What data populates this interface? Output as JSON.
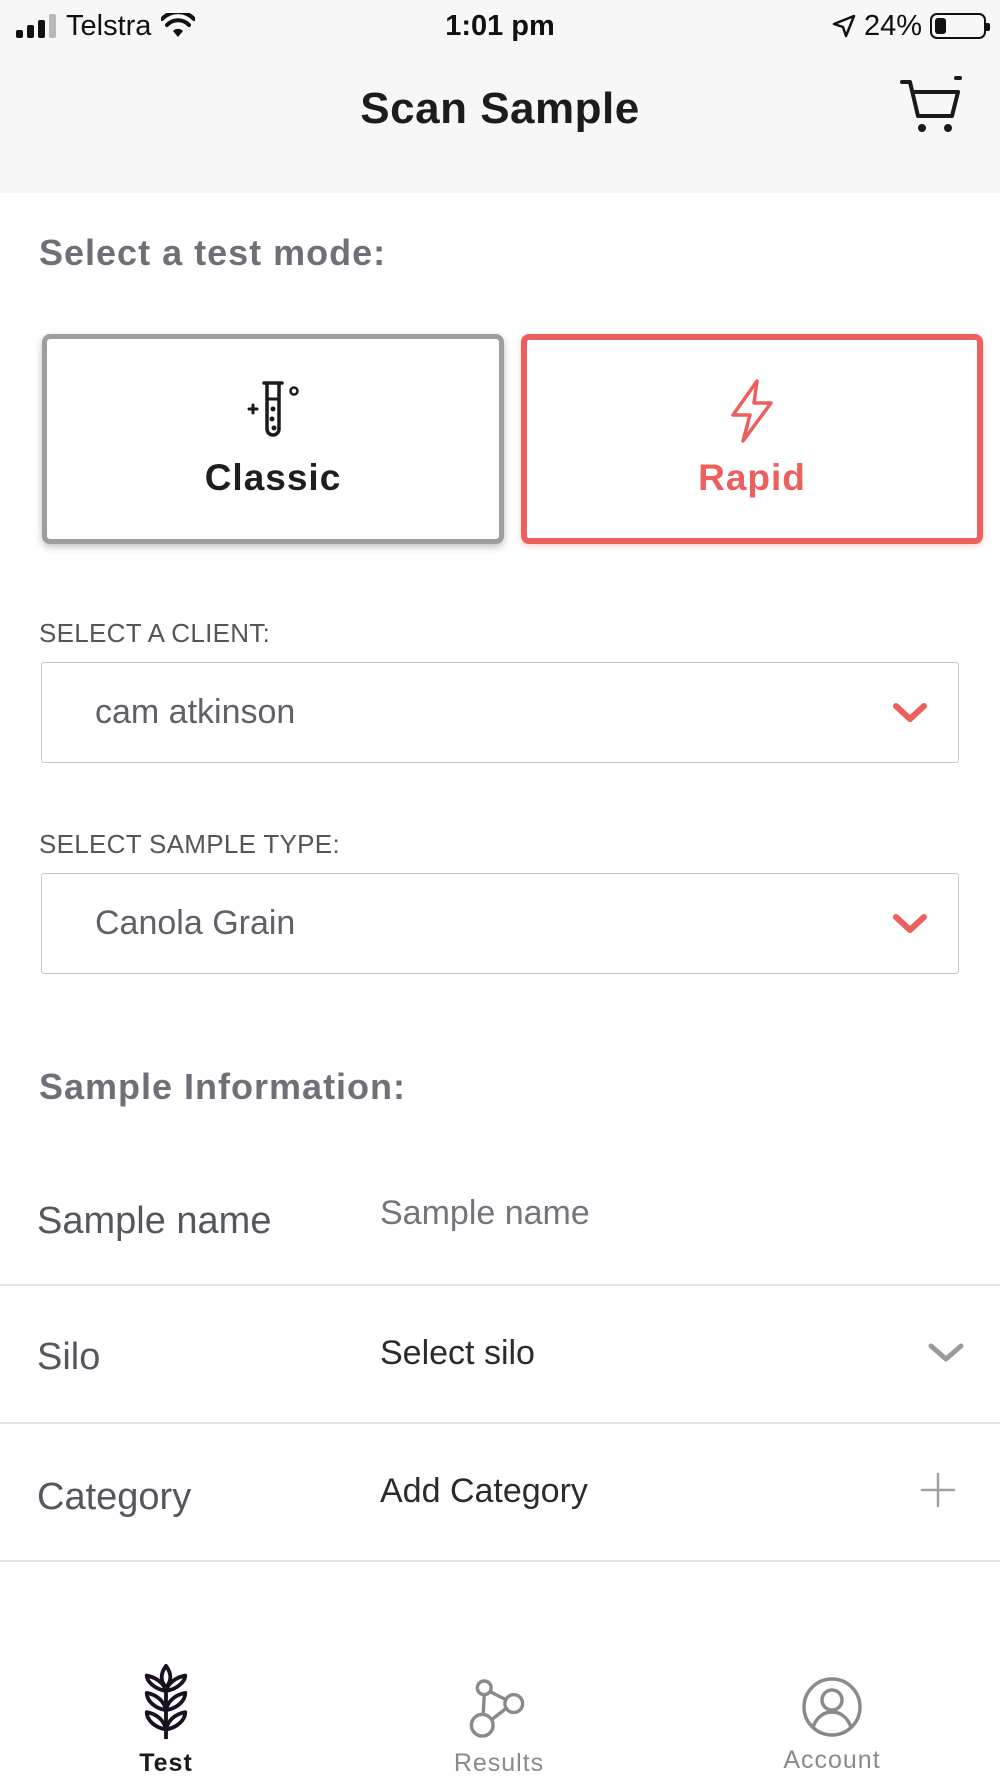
{
  "status_bar": {
    "carrier": "Telstra",
    "time": "1:01 pm",
    "battery_percent": "24%",
    "battery_level": 0.24
  },
  "header": {
    "title": "Scan Sample",
    "cart_icon": "cart-icon"
  },
  "test_mode": {
    "heading": "Select a test mode:",
    "options": [
      {
        "label": "Classic",
        "icon": "test-tube-icon",
        "selected": false
      },
      {
        "label": "Rapid",
        "icon": "lightning-icon",
        "selected": true
      }
    ]
  },
  "client": {
    "label": "SELECT A CLIENT:",
    "value": "cam atkinson"
  },
  "sample_type": {
    "label": "SELECT SAMPLE TYPE:",
    "value": "Canola Grain"
  },
  "sample_info": {
    "heading": "Sample Information:",
    "name_label": "Sample name",
    "name_placeholder": "Sample name",
    "silo_label": "Silo",
    "silo_value": "Select silo",
    "category_label": "Category",
    "category_value": "Add Category"
  },
  "tabs": [
    {
      "label": "Test",
      "icon": "wheat-icon",
      "active": true
    },
    {
      "label": "Results",
      "icon": "molecule-icon",
      "active": false
    },
    {
      "label": "Account",
      "icon": "user-icon",
      "active": false
    }
  ],
  "colors": {
    "accent": "#ec5f5c",
    "header_bg": "#f7f7f7",
    "inactive_tab": "#8a8a8a",
    "active_tab": "#1a1a1a"
  }
}
